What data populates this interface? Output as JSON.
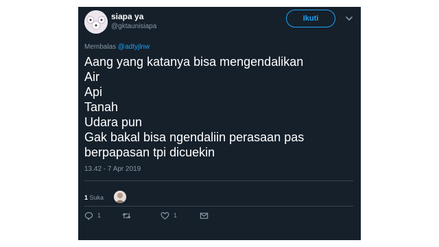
{
  "tweet": {
    "display_name": "siapa ya",
    "handle": "@gktaunisiapa",
    "follow_label": "Ikuti",
    "reply_prefix": "Membalas",
    "reply_to": "@adtyjlnw",
    "text_lines": [
      "Aang yang katanya bisa mengendalikan",
      "Air",
      "Api",
      "Tanah",
      "Udara pun",
      "Gak bakal bisa ngendaliin perasaan pas",
      "berpapasan tpi dicuekin"
    ],
    "timestamp": "13.42 - 7 Apr 2019",
    "likes_number": "1",
    "likes_word": "Suka",
    "actions": {
      "reply_count": "1",
      "retweet_count": "",
      "like_count": "1"
    }
  },
  "colors": {
    "background": "#15202b",
    "accent": "#1da1f2",
    "muted": "#8899a6",
    "text": "#ffffff"
  },
  "icons": {
    "more": "chevron-down-icon",
    "reply": "reply-icon",
    "retweet": "retweet-icon",
    "like": "heart-icon",
    "message": "envelope-icon"
  }
}
